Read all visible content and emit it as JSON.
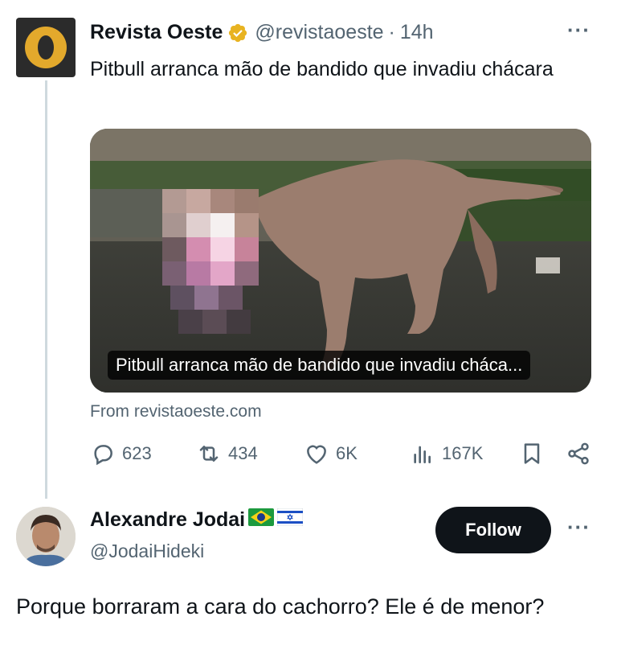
{
  "tweet": {
    "author_name": "Revista Oeste",
    "author_handle": "@revistaoeste",
    "separator": "·",
    "time": "14h",
    "more_label": "···",
    "text": "Pitbull arranca mão de bandido que invadiu chácara",
    "media_caption": "Pitbull arranca mão de bandido que invadiu cháca...",
    "source": "From revistaoeste.com",
    "stats": {
      "replies": "623",
      "retweets": "434",
      "likes": "6K",
      "views": "167K"
    }
  },
  "reply": {
    "author_name": "Alexandre Jodai",
    "author_handle": "@JodaiHideki",
    "follow_label": "Follow",
    "more_label": "···",
    "text": "Porque borraram a cara do cachorro? Ele é de menor?"
  },
  "colors": {
    "text_primary": "#0f1419",
    "text_secondary": "#536471",
    "verified_gold": "#e8b321",
    "button_dark": "#0f1419"
  },
  "icons": [
    "org-logo-icon",
    "verified-badge-icon",
    "reply-icon",
    "retweet-icon",
    "like-icon",
    "views-icon",
    "bookmark-icon",
    "share-icon",
    "brazil-flag-icon",
    "israel-flag-icon"
  ]
}
